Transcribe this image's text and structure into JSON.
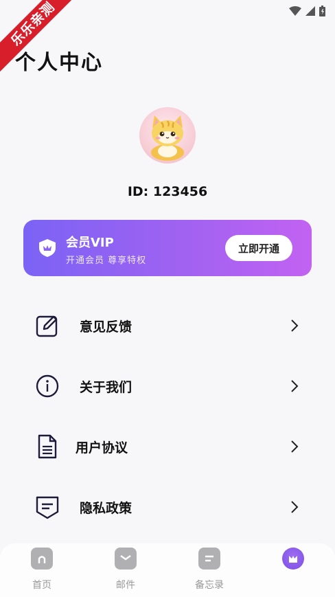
{
  "watermark": "乐乐亲测",
  "page": {
    "title": "个人中心"
  },
  "profile": {
    "id_text": "ID: 123456"
  },
  "vip": {
    "title": "会员VIP",
    "subtitle": "开通会员  尊享特权",
    "button_label": "立即开通",
    "gradient_start": "#7b63f5",
    "gradient_end": "#c262f2"
  },
  "menu": [
    {
      "label": "意见反馈",
      "icon": "edit-icon"
    },
    {
      "label": "关于我们",
      "icon": "info-icon"
    },
    {
      "label": "用户协议",
      "icon": "document-icon"
    },
    {
      "label": "隐私政策",
      "icon": "policy-icon"
    }
  ],
  "tabs": [
    {
      "label": "首页",
      "icon": "home-icon"
    },
    {
      "label": "邮件",
      "icon": "mail-icon"
    },
    {
      "label": "备忘录",
      "icon": "memo-icon"
    },
    {
      "label": "",
      "icon": "profile-icon",
      "active": true
    }
  ],
  "colors": {
    "accent": "#8a5cf0",
    "tab_inactive": "#999999"
  }
}
